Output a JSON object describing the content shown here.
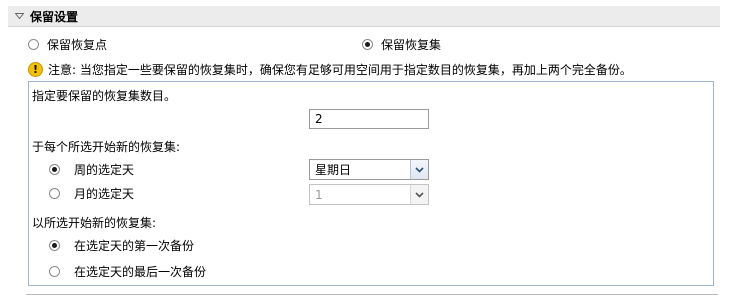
{
  "section": {
    "title": "保留设置"
  },
  "retention_mode": {
    "options": [
      {
        "label": "保留恢复点",
        "checked": false
      },
      {
        "label": "保留恢复集",
        "checked": true
      }
    ]
  },
  "note": {
    "text": "注意: 当您指定一些要保留的恢复集时，确保您有足够可用空间用于指定数目的恢复集，再加上两个完全备份。"
  },
  "panel": {
    "count_label": "指定要保留的恢复集数目。",
    "count_value": "2",
    "start_label": "于每个所选开始新的恢复集:",
    "start_options": [
      {
        "label": "周的选定天",
        "checked": true,
        "select_value": "星期日",
        "enabled": true
      },
      {
        "label": "月的选定天",
        "checked": false,
        "select_value": "1",
        "enabled": false
      }
    ],
    "begin_label": "以所选开始新的恢复集:",
    "begin_options": [
      {
        "label": "在选定天的第一次备份",
        "checked": true
      },
      {
        "label": "在选定天的最后一次备份",
        "checked": false
      }
    ]
  },
  "icons": {
    "collapse": "triangle-down-icon",
    "warning": "warning-icon",
    "dropdown": "chevron-down-icon"
  },
  "colors": {
    "header_bg": "#ececec",
    "panel_border": "#9fb6cd",
    "warning": "#f2c200"
  }
}
